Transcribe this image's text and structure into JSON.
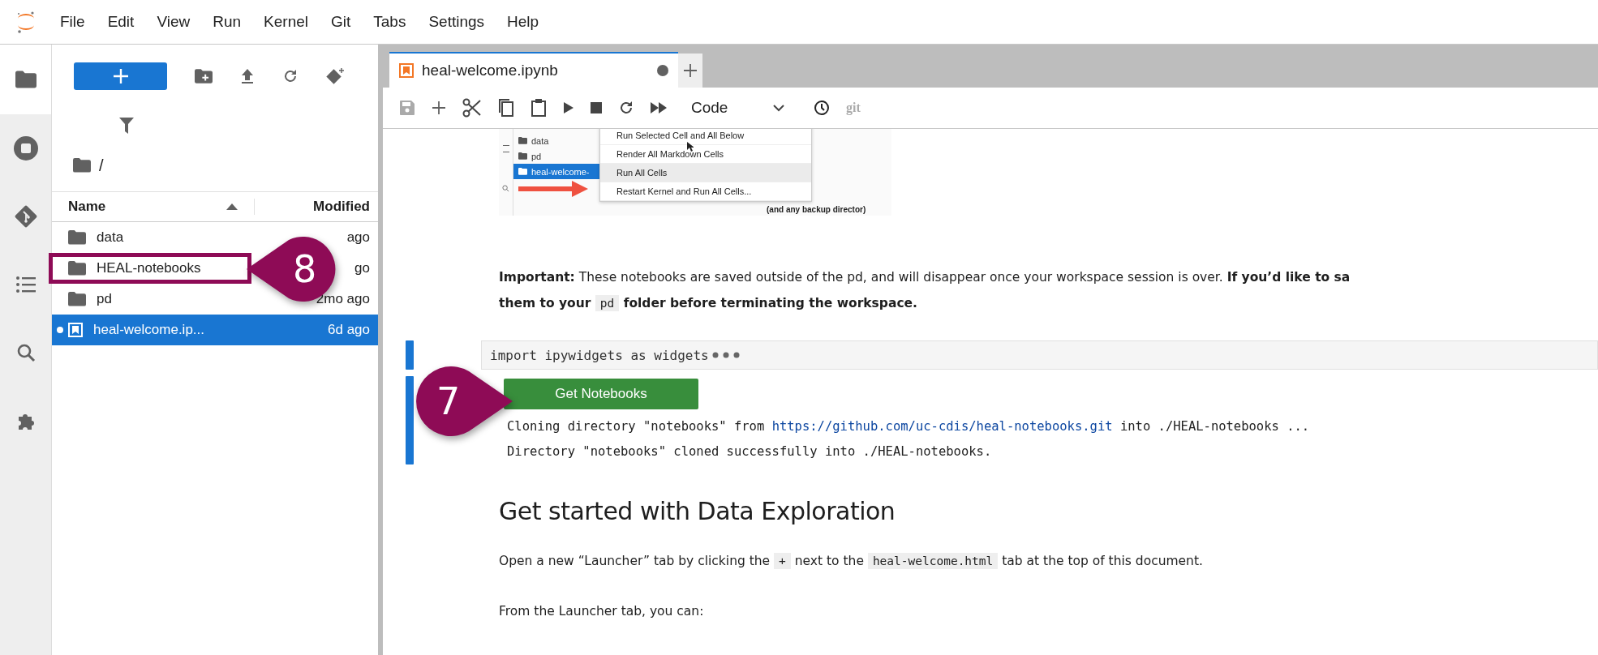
{
  "menu_bar": {
    "items": [
      "File",
      "Edit",
      "View",
      "Run",
      "Kernel",
      "Git",
      "Tabs",
      "Settings",
      "Help"
    ]
  },
  "activity_bar": {
    "items": [
      {
        "kind": "folder",
        "selected": true
      },
      {
        "kind": "running",
        "selected": false
      },
      {
        "kind": "git",
        "selected": false
      },
      {
        "kind": "toc",
        "selected": false
      },
      {
        "kind": "search",
        "selected": false
      },
      {
        "kind": "extension",
        "selected": false
      }
    ]
  },
  "file_browser": {
    "path": "/",
    "columns": [
      "Name",
      "Modified"
    ],
    "rows": [
      {
        "kind": "folder",
        "name": "data",
        "modified": "ago",
        "selected": false,
        "running": false
      },
      {
        "kind": "folder",
        "name": "HEAL-notebooks",
        "modified": "go",
        "selected": false,
        "running": false,
        "highlighted": true
      },
      {
        "kind": "folder",
        "name": "pd",
        "modified": "2mo ago",
        "selected": false,
        "running": false
      },
      {
        "kind": "notebook",
        "name": "heal-welcome.ip...",
        "modified": "6d ago",
        "selected": true,
        "running": true
      }
    ]
  },
  "notebook": {
    "tab": {
      "title": "heal-welcome.ipynb",
      "unsaved": true
    },
    "cell_type": "Code",
    "git_label": "git",
    "embedded_screenshot": {
      "files": [
        {
          "name": "data",
          "selected": false
        },
        {
          "name": "pd",
          "selected": false
        },
        {
          "name": "heal-welcome-",
          "selected": true
        }
      ],
      "menu": [
        {
          "label": "Run Selected Cell and All Below",
          "selected": false
        },
        {
          "label": "Render All Markdown Cells",
          "selected": false
        },
        {
          "label": "Run All Cells",
          "selected": true
        },
        {
          "label": "Restart Kernel and Run All Cells...",
          "selected": false
        }
      ],
      "note": "(and any backup director)"
    },
    "important": [
      [
        {
          "text": "Important:",
          "bold": true
        },
        {
          "text": " These notebooks are saved outside of the pd, and will disappear once your workspace session is over. ",
          "bold": false
        },
        {
          "text": "If you’d like to sa",
          "bold": true
        }
      ],
      [
        {
          "text": "them to your ",
          "bold": true
        },
        {
          "text": "pd",
          "code": true
        },
        {
          "text": " folder before terminating the workspace.",
          "bold": true
        }
      ]
    ],
    "code_cell": "import ipywidgets as widgets",
    "widget_button": "Get Notebooks",
    "output": [
      [
        {
          "text": "Cloning directory \"notebooks\" from "
        },
        {
          "text": "https://github.com/uc-cdis/heal-notebooks.git",
          "link": true
        },
        {
          "text": " into ./HEAL-notebooks ..."
        }
      ],
      [
        {
          "text": "Directory \"notebooks\" cloned successfully into ./HEAL-notebooks."
        }
      ]
    ],
    "heading": "Get started with Data Exploration",
    "paragraphs": [
      [
        {
          "text": "Open a new “Launcher” tab by clicking the "
        },
        {
          "text": "+",
          "code": true
        },
        {
          "text": " next to the "
        },
        {
          "text": "heal-welcome.html",
          "code": true
        },
        {
          "text": " tab at the top of this document."
        }
      ],
      [
        {
          "text": "From the Launcher tab, you can:"
        }
      ]
    ]
  },
  "annotations": {
    "file_callout": {
      "number": "8"
    },
    "button_callout": {
      "number": "7"
    }
  }
}
